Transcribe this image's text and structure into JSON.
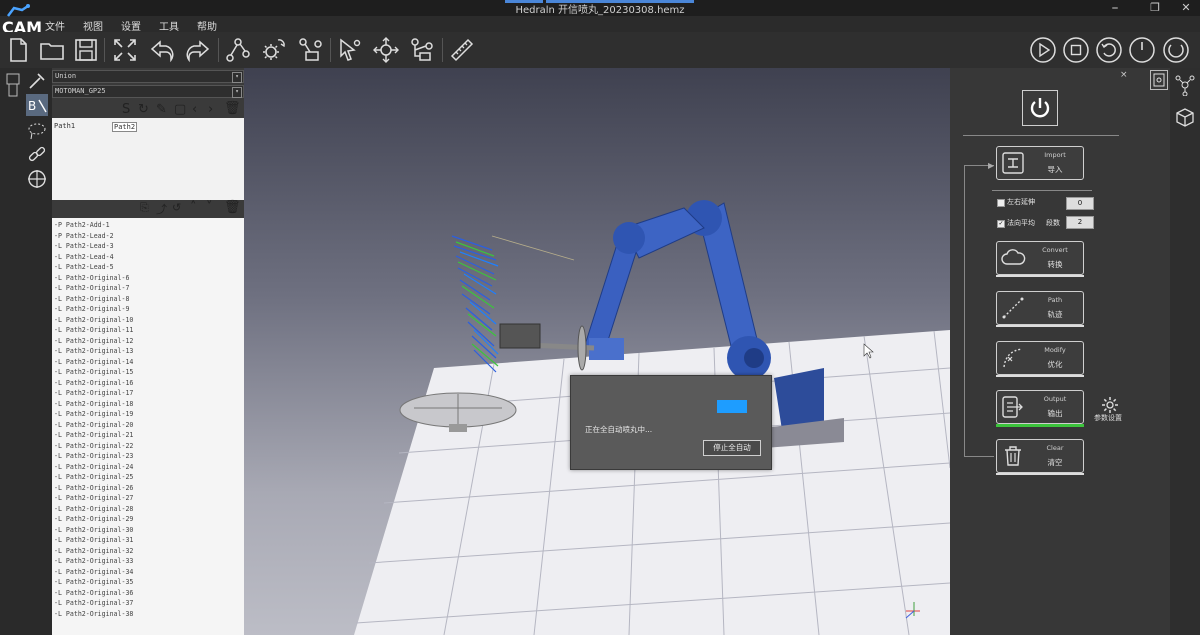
{
  "window": {
    "title": "Hedraln  开信喷丸_20230308.hemz",
    "controls": [
      "⎯",
      "❐",
      "✕"
    ]
  },
  "logo": {
    "text": "CAM"
  },
  "menu": [
    "文件",
    "视图",
    "设置",
    "工具",
    "帮助"
  ],
  "toolbar": {
    "icons": [
      "new-file-icon",
      "open-folder-icon",
      "save-icon",
      "fit-view-icon",
      "undo-icon",
      "redo-icon",
      "path-node-icon",
      "path-settings-icon",
      "robot-path-icon",
      "select-arrow-icon",
      "move-gizmo-icon",
      "tree-node-icon",
      "ruler-icon"
    ],
    "controls": [
      "play-icon",
      "stop-icon",
      "reset-icon",
      "power-icon"
    ]
  },
  "left_panel": {
    "dropdown1": "Union",
    "dropdown2": "MOTOMAN_GP25",
    "paths": [
      "Path1",
      "Path2"
    ],
    "tree_items": [
      "-P Path2-Add-1",
      "-P Path2-Lead-2",
      "-L Path2-Lead-3",
      "-L Path2-Lead-4",
      "-L Path2-Lead-5",
      "-L Path2-Original-6",
      "-L Path2-Original-7",
      "-L Path2-Original-8",
      "-L Path2-Original-9",
      "-L Path2-Original-10",
      "-L Path2-Original-11",
      "-L Path2-Original-12",
      "-L Path2-Original-13",
      "-L Path2-Original-14",
      "-L Path2-Original-15",
      "-L Path2-Original-16",
      "-L Path2-Original-17",
      "-L Path2-Original-18",
      "-L Path2-Original-19",
      "-L Path2-Original-20",
      "-L Path2-Original-21",
      "-L Path2-Original-22",
      "-L Path2-Original-23",
      "-L Path2-Original-24",
      "-L Path2-Original-25",
      "-L Path2-Original-26",
      "-L Path2-Original-27",
      "-L Path2-Original-28",
      "-L Path2-Original-29",
      "-L Path2-Original-30",
      "-L Path2-Original-31",
      "-L Path2-Original-32",
      "-L Path2-Original-33",
      "-L Path2-Original-34",
      "-L Path2-Original-35",
      "-L Path2-Original-36",
      "-L Path2-Original-37",
      "-L Path2-Original-38"
    ]
  },
  "dialog": {
    "message": "正在全自动喷丸中...",
    "stop_label": "停止全自动",
    "progress_color": "#1e9dff"
  },
  "right_panel": {
    "import": {
      "en": "Import",
      "zh": "导入"
    },
    "mirror_label": "左右延伸",
    "mirror_value": "0",
    "normal_avg_label": "法向平均",
    "segments_label": "段数",
    "segments_value": "2",
    "convert": {
      "en": "Convert",
      "zh": "转换"
    },
    "path": {
      "en": "Path",
      "zh": "轨迹"
    },
    "modify": {
      "en": "Modify",
      "zh": "优化"
    },
    "output": {
      "en": "Output",
      "zh": "输出"
    },
    "clear": {
      "en": "Clear",
      "zh": "清空"
    },
    "settings_label": "参数设置",
    "accent_green": "#3cc43c"
  }
}
